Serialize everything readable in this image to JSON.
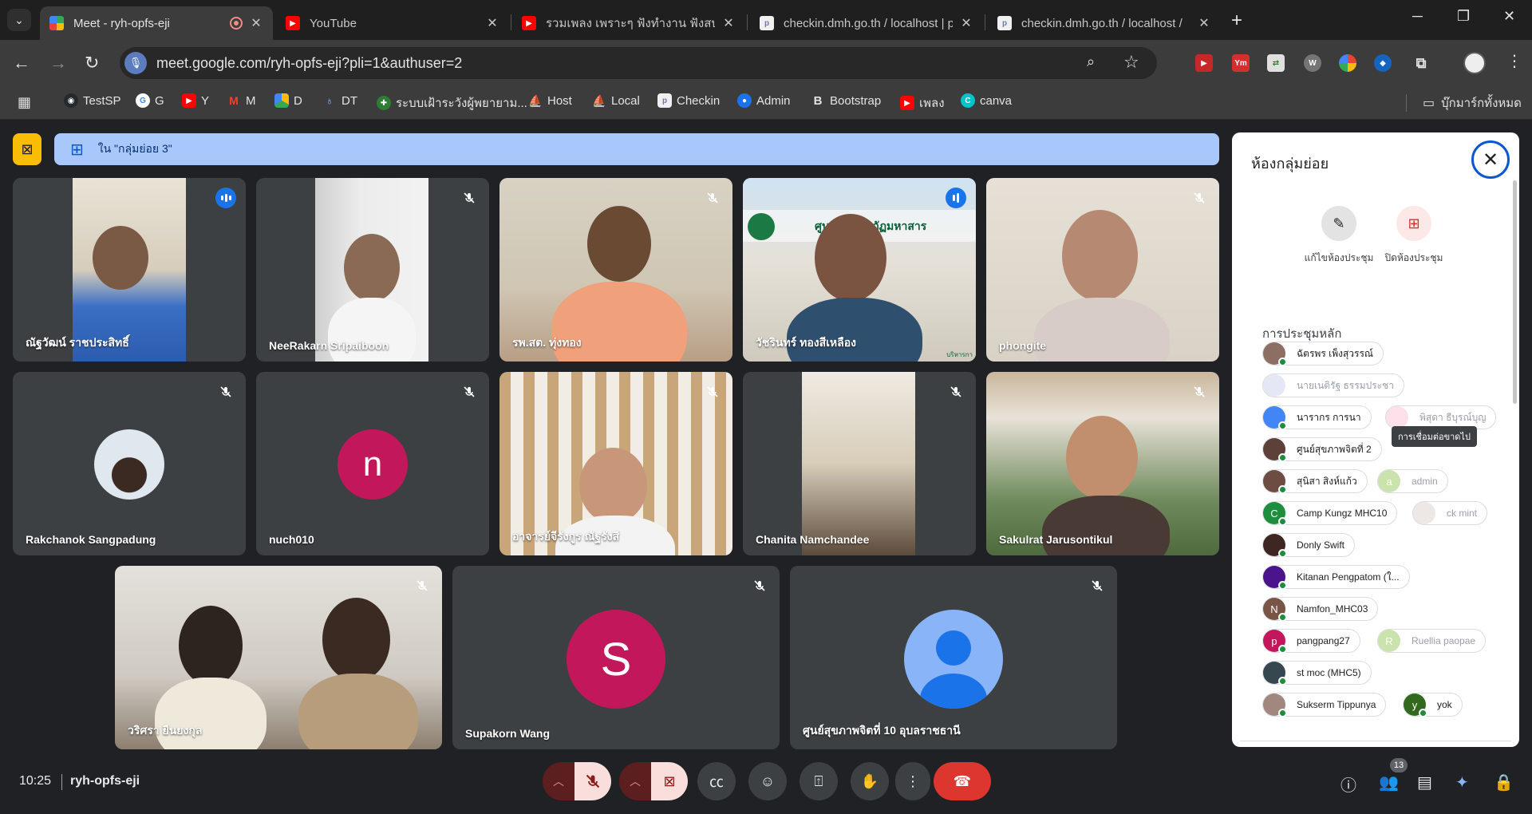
{
  "browser": {
    "tabs": [
      {
        "title": "Meet - ryh-opfs-eji",
        "active": true,
        "favicon": "google-meet-icon"
      },
      {
        "title": "YouTube",
        "active": false,
        "favicon": "youtube-icon"
      },
      {
        "title": "รวมเพลง เพราะๆ ฟังทำงาน ฟังสบายๆ",
        "active": false,
        "favicon": "youtube-icon"
      },
      {
        "title": "checkin.dmh.go.th / localhost | p",
        "active": false,
        "favicon": "phpmyadmin-icon"
      },
      {
        "title": "checkin.dmh.go.th / localhost / ",
        "active": false,
        "favicon": "phpmyadmin-icon"
      }
    ],
    "url": "meet.google.com/ryh-opfs-eji?pli=1&authuser=2",
    "bookmarks": [
      {
        "label": "TestSP",
        "icon": "github-icon"
      },
      {
        "label": "G",
        "icon": "google-icon"
      },
      {
        "label": "Y",
        "icon": "youtube-icon"
      },
      {
        "label": "M",
        "icon": "gmail-icon"
      },
      {
        "label": "D",
        "icon": "drive-icon"
      },
      {
        "label": "DT",
        "icon": "dt-icon"
      },
      {
        "label": "ระบบเฝ้าระวังผู้พยายาม...",
        "icon": "dmh-icon"
      },
      {
        "label": "Host",
        "icon": "host-icon"
      },
      {
        "label": "Local",
        "icon": "local-icon"
      },
      {
        "label": "Checkin",
        "icon": "checkin-icon"
      },
      {
        "label": "Admin",
        "icon": "admin-icon"
      },
      {
        "label": "Bootstrap",
        "icon": "bootstrap-icon"
      },
      {
        "label": "เพลง",
        "icon": "youtube-icon"
      },
      {
        "label": "canva",
        "icon": "canva-icon"
      }
    ],
    "all_bookmarks": "บุ๊กมาร์กทั้งหมด"
  },
  "meet": {
    "banner": "ใน \"กลุ่มย่อย 3\"",
    "tiles": [
      {
        "name": "ณัฐวัฒน์ ราชประสิทธิ์",
        "status": "speaking"
      },
      {
        "name": "NeeRakarn Sripaiboon",
        "status": "muted"
      },
      {
        "name": "รพ.สต. ทุ่งทอง",
        "status": "muted"
      },
      {
        "name": "วัชรินทร์ ทองสีเหลือง",
        "status": "speaking"
      },
      {
        "name": "phongite",
        "status": "muted"
      },
      {
        "name": "Rakchanok Sangpadung",
        "status": "muted"
      },
      {
        "name": "nuch010",
        "status": "muted",
        "letter": "n"
      },
      {
        "name": "อาจารย์จีรังกูร ณัฐรังสี",
        "status": "muted"
      },
      {
        "name": "Chanita Namchandee",
        "status": "muted"
      },
      {
        "name": "Sakulrat Jarusontikul",
        "status": "muted"
      },
      {
        "name": "วริศรา ยืนยงกุล",
        "status": "muted"
      },
      {
        "name": "Supakorn Wang",
        "status": "muted",
        "letter": "S"
      },
      {
        "name": "ศูนย์สุขภาพจิตที่ 10 อุบลราชธานี",
        "status": "muted"
      }
    ],
    "tile4_overlay": "ศูนย์...ยราชภัฏมหาสาร",
    "tile4_tag": "บริหารกา",
    "panel": {
      "title": "ห้องกลุ่มย่อย",
      "edit_label": "แก้ไขห้องประชุม",
      "close_rooms_label": "ปิดห้องประชุม",
      "section": "การประชุมหลัก",
      "tooltip": "การเชื่อมต่อขาดไป",
      "participants": [
        {
          "name": "ฉัตรพร เพ็งสุวรรณ์",
          "online": true,
          "avatar_color": "#8d6e63"
        },
        {
          "name": "นายเนติรัฐ ธรรมประชา",
          "online": false,
          "avatar_color": "#c5cae9"
        },
        {
          "name": "นารากร การนา",
          "online": true,
          "avatar_color": "#4285f4"
        },
        {
          "name": "พิสุดา ธีบุรณ์บุญ",
          "online": false,
          "avatar_color": "#f8bbd0"
        },
        {
          "name": "ศูนย์สุขภาพจิตที่ 2",
          "online": true,
          "avatar_color": "#5d4037"
        },
        {
          "name": "สุนิสา สิงห์แก้ว",
          "online": true,
          "avatar_color": "#6d4c41"
        },
        {
          "name": "admin",
          "online": false,
          "avatar_color": "#8bc34a",
          "letter": "a"
        },
        {
          "name": "Camp Kungz MHC10",
          "online": true,
          "avatar_color": "#1e8e3e",
          "letter": "C"
        },
        {
          "name": "ck mint",
          "online": false,
          "avatar_color": "#d7ccc8"
        },
        {
          "name": "Donly Swift",
          "online": true,
          "avatar_color": "#3e2723"
        },
        {
          "name": "Kitanan Pengpatom (ใ...",
          "online": true,
          "avatar_color": "#4a148c"
        },
        {
          "name": "Namfon_MHC03",
          "online": true,
          "avatar_color": "#795548",
          "letter": "N"
        },
        {
          "name": "pangpang27",
          "online": true,
          "avatar_color": "#c2185b",
          "letter": "p"
        },
        {
          "name": "Ruellia paopae",
          "online": false,
          "avatar_color": "#8bc34a",
          "letter": "R"
        },
        {
          "name": "st moc (MHC5)",
          "online": true,
          "avatar_color": "#37474f"
        },
        {
          "name": "Sukserm Tippunya",
          "online": true,
          "avatar_color": "#a1887f"
        },
        {
          "name": "yok",
          "online": true,
          "avatar_color": "#33691e",
          "letter": "y"
        }
      ]
    },
    "time": "10:25",
    "meeting_code": "ryh-opfs-eji",
    "participant_count": "13"
  }
}
